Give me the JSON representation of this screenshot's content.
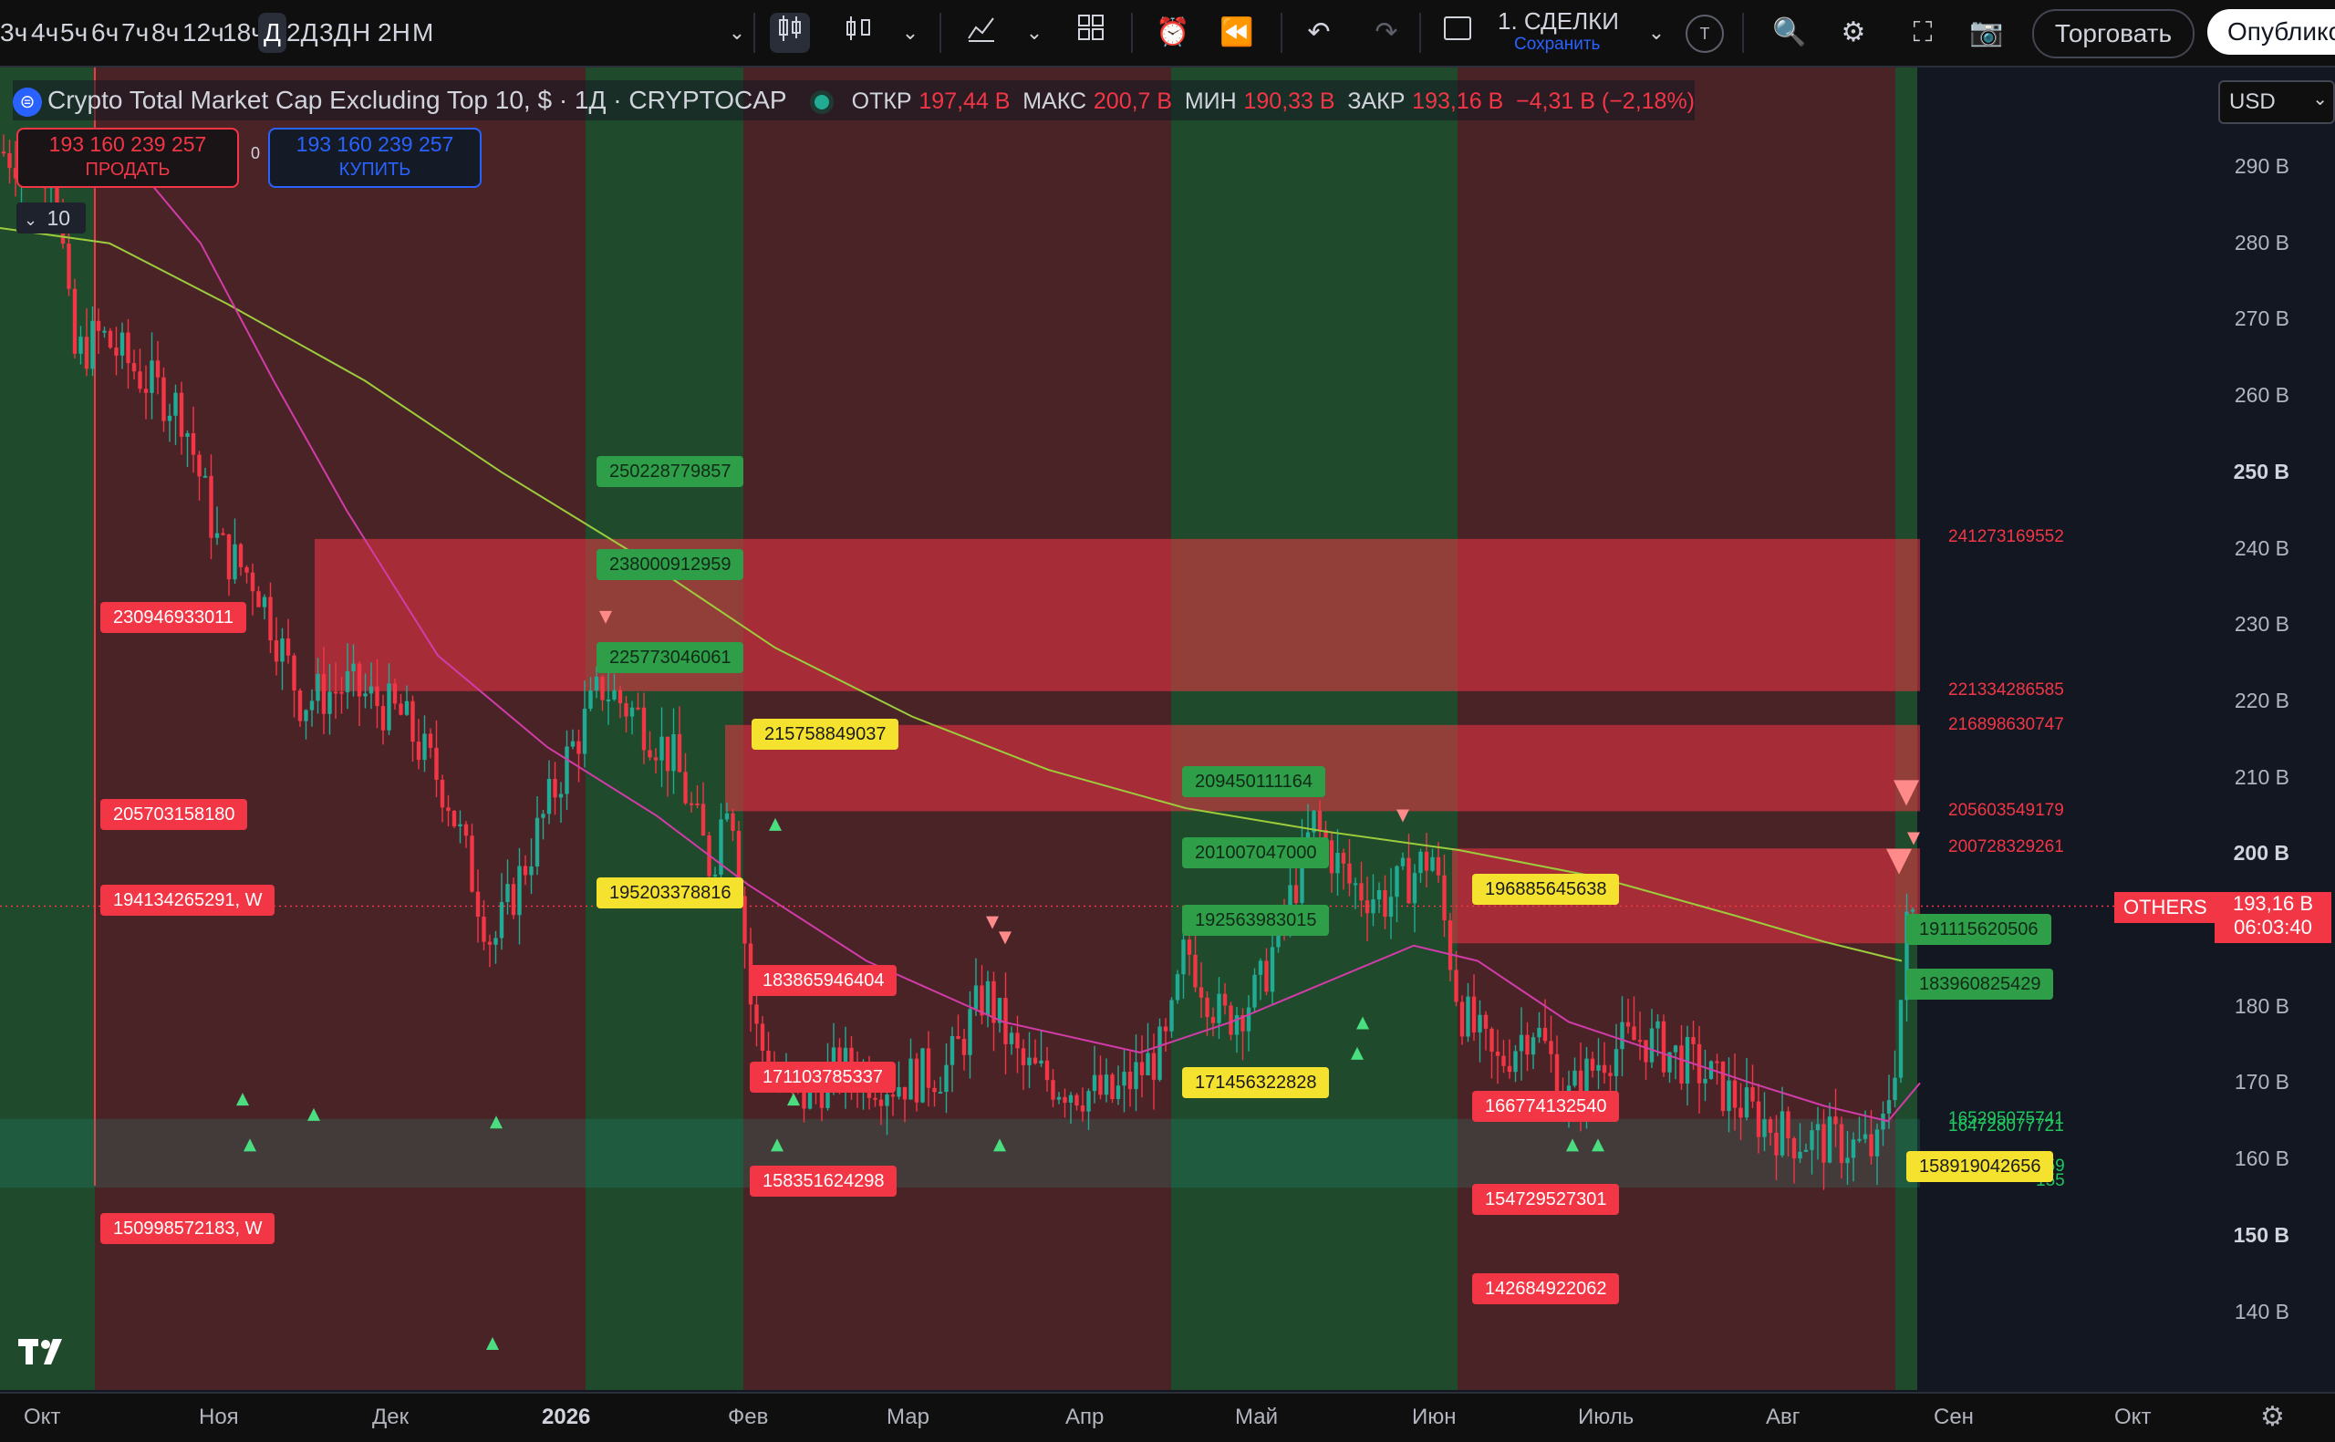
{
  "toolbar": {
    "timeframes": [
      "3ч",
      "4ч",
      "5ч",
      "6ч",
      "7ч",
      "8ч",
      "12ч",
      "18ч",
      "Д",
      "2Д",
      "3Д",
      "Н",
      "2Н",
      "М"
    ],
    "active_timeframe": "Д",
    "strategy_title": "1. СДЕЛКИ",
    "strategy_sub": "Сохранить",
    "avatar_letter": "T",
    "trade_label": "Торговать",
    "publish_label": "Опублико"
  },
  "legend": {
    "symbol": "Crypto Total Market Cap Excluding Top 10, $ · 1Д · CRYPTOCAP",
    "open_label": "ОТКР",
    "open_value": "197,44 B",
    "high_label": "МАКС",
    "high_value": "200,7 B",
    "low_label": "МИН",
    "low_value": "190,33 B",
    "close_label": "ЗАКР",
    "close_value": "193,16 B",
    "change": "−4,31 B (−2,18%)"
  },
  "order": {
    "sell_price": "193 160 239 257",
    "sell_label": "ПРОДАТЬ",
    "spread": "0",
    "buy_price": "193 160 239 257",
    "buy_label": "КУПИТЬ",
    "collapse_count": "10"
  },
  "currency": "USD",
  "y_axis": {
    "ticks": [
      {
        "label": "290 B",
        "bold": false
      },
      {
        "label": "280 B",
        "bold": false
      },
      {
        "label": "270 B",
        "bold": false
      },
      {
        "label": "260 B",
        "bold": false
      },
      {
        "label": "250 B",
        "bold": true
      },
      {
        "label": "240 B",
        "bold": false
      },
      {
        "label": "230 B",
        "bold": false
      },
      {
        "label": "220 B",
        "bold": false
      },
      {
        "label": "210 B",
        "bold": false
      },
      {
        "label": "200 B",
        "bold": true
      },
      {
        "label": "180 B",
        "bold": false
      },
      {
        "label": "170 B",
        "bold": false
      },
      {
        "label": "160 B",
        "bold": false
      },
      {
        "label": "150 B",
        "bold": true
      },
      {
        "label": "140 B",
        "bold": false
      }
    ],
    "symbol_tag": "OTHERS",
    "price_tag": "193,16 B",
    "countdown": "06:03:40"
  },
  "x_axis": {
    "labels": [
      {
        "label": "Окт",
        "bold": false
      },
      {
        "label": "Ноя",
        "bold": false
      },
      {
        "label": "Дек",
        "bold": false
      },
      {
        "label": "2026",
        "bold": true
      },
      {
        "label": "Фев",
        "bold": false
      },
      {
        "label": "Мар",
        "bold": false
      },
      {
        "label": "Апр",
        "bold": false
      },
      {
        "label": "Май",
        "bold": false
      },
      {
        "label": "Июн",
        "bold": false
      },
      {
        "label": "Июль",
        "bold": false
      },
      {
        "label": "Авг",
        "bold": false
      },
      {
        "label": "Сен",
        "bold": false
      },
      {
        "label": "Окт",
        "bold": false
      }
    ]
  },
  "chart_labels": [
    {
      "text": "250228779857",
      "color": "green"
    },
    {
      "text": "238000912959",
      "color": "green"
    },
    {
      "text": "225773046061",
      "color": "green"
    },
    {
      "text": "215758849037",
      "color": "yellow"
    },
    {
      "text": "230946933011",
      "color": "red"
    },
    {
      "text": "205703158180",
      "color": "red"
    },
    {
      "text": "194134265291, W",
      "color": "red"
    },
    {
      "text": "150998572183, W",
      "color": "red"
    },
    {
      "text": "195203378816",
      "color": "yellow"
    },
    {
      "text": "183865946404",
      "color": "red"
    },
    {
      "text": "171103785337",
      "color": "red"
    },
    {
      "text": "158351624298",
      "color": "red"
    },
    {
      "text": "209450111164",
      "color": "green"
    },
    {
      "text": "201007047000",
      "color": "green"
    },
    {
      "text": "192563983015",
      "color": "green"
    },
    {
      "text": "171456322828",
      "color": "yellow"
    },
    {
      "text": "196885645638",
      "color": "yellow"
    },
    {
      "text": "166774132540",
      "color": "red"
    },
    {
      "text": "154729527301",
      "color": "red"
    },
    {
      "text": "142684922062",
      "color": "red"
    },
    {
      "text": "191115620506",
      "color": "green"
    },
    {
      "text": "183960825429",
      "color": "green"
    },
    {
      "text": "158919042656",
      "color": "yellow"
    }
  ],
  "right_levels": [
    {
      "text": "241273169552",
      "color": "#f23645"
    },
    {
      "text": "221334286585",
      "color": "#f23645"
    },
    {
      "text": "216898630747",
      "color": "#f23645"
    },
    {
      "text": "205603549179",
      "color": "#f23645"
    },
    {
      "text": "200728329261",
      "color": "#f23645"
    },
    {
      "text": "165295075741",
      "color": "#22c55e"
    },
    {
      "text": "164728077721",
      "color": "#22c55e"
    },
    {
      "text": "159",
      "color": "#22c55e"
    },
    {
      "text": "155",
      "color": "#22c55e"
    }
  ]
}
